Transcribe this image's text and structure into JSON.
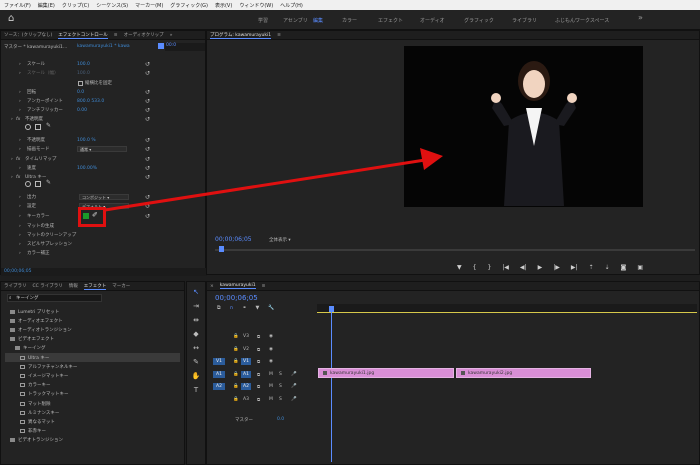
{
  "menu": [
    "ファイル(F)",
    "編集(E)",
    "クリップ(C)",
    "シーケンス(S)",
    "マーカー(M)",
    "グラフィック(G)",
    "表示(V)",
    "ウィンドウ(W)",
    "ヘルプ(H)"
  ],
  "workspaces": [
    "学習",
    "アセンブリ",
    "編集",
    "カラー",
    "エフェクト",
    "オーディオ",
    "グラフィック",
    "ライブラリ",
    "ふじもんワークスペース"
  ],
  "workspace_more": "»",
  "effect_panel": {
    "tabs": [
      "ソース：(クリップなし)",
      "エフェクトコントロール",
      "オーディオクリップ"
    ],
    "active_tab": "エフェクトコントロール",
    "menu_icon": "≡",
    "more": "»",
    "master_label": "マスター * kawamurayuki1...",
    "clip_label": "kawamurayuki1 * kawa",
    "timecode_marker": "00:0",
    "rows": [
      {
        "label": "スケール",
        "value": "100.0"
      },
      {
        "label": "スケール（幅）",
        "value": "100.0"
      },
      {
        "label": "縦横比を固定",
        "value": ""
      },
      {
        "label": "回転",
        "value": "0.0"
      },
      {
        "label": "アンカーポイント",
        "value": "800.0    533.0"
      },
      {
        "label": "アンチフリッカー",
        "value": "0.00"
      },
      {
        "label": "不透明度",
        "value": ""
      },
      {
        "label": "不透明度",
        "value": "100.0 %"
      },
      {
        "label": "描画モード",
        "value": "通常"
      },
      {
        "label": "タイムリマップ",
        "value": ""
      },
      {
        "label": "速度",
        "value": "100.00%"
      },
      {
        "label": "Ultra キー",
        "value": ""
      },
      {
        "label": "出力",
        "value": "コンポジット"
      },
      {
        "label": "設定",
        "value": "デフォルト"
      },
      {
        "label": "キーカラー",
        "value": ""
      },
      {
        "label": "マットの生成",
        "value": ""
      },
      {
        "label": "マットのクリーンアップ",
        "value": ""
      },
      {
        "label": "スピルサプレッション",
        "value": ""
      },
      {
        "label": "カラー補正",
        "value": ""
      }
    ],
    "footer_time": "00;00;06;05"
  },
  "program": {
    "title": "プログラム: kawamurayuki1",
    "menu_icon": "≡",
    "timecode": "00;00;06;05",
    "fit": "全体表示",
    "controls": [
      "marker-add",
      "in",
      "out",
      "go-in",
      "step-back",
      "play",
      "step-forward",
      "go-out",
      "lift",
      "extract",
      "export-frame",
      "compare"
    ]
  },
  "effects_panel": {
    "tabs": [
      "ライブラリ",
      "CC ライブラリ",
      "情報",
      "エフェクト",
      "マーカー"
    ],
    "active_tab": "エフェクト",
    "search_value": "キーイング",
    "items": [
      {
        "label": "Lumetri プリセット",
        "indent": 1,
        "type": "folder"
      },
      {
        "label": "オーディオエフェクト",
        "indent": 1,
        "type": "folder"
      },
      {
        "label": "オーディオトランジション",
        "indent": 1,
        "type": "folder"
      },
      {
        "label": "ビデオエフェクト",
        "indent": 1,
        "type": "folder"
      },
      {
        "label": "キーイング",
        "indent": 2,
        "type": "folder"
      },
      {
        "label": "Ultra キー",
        "indent": 3,
        "type": "fx",
        "selected": true
      },
      {
        "label": "アルファチャンネルキー",
        "indent": 3,
        "type": "fx"
      },
      {
        "label": "イメージマットキー",
        "indent": 3,
        "type": "fx"
      },
      {
        "label": "カラーキー",
        "indent": 3,
        "type": "fx"
      },
      {
        "label": "トラックマットキー",
        "indent": 3,
        "type": "fx"
      },
      {
        "label": "マット削除",
        "indent": 3,
        "type": "fx"
      },
      {
        "label": "ルミナンスキー",
        "indent": 3,
        "type": "fx"
      },
      {
        "label": "異なるマット",
        "indent": 3,
        "type": "fx"
      },
      {
        "label": "非赤キー",
        "indent": 3,
        "type": "fx"
      },
      {
        "label": "ビデオトランジション",
        "indent": 1,
        "type": "folder"
      }
    ]
  },
  "timeline": {
    "tab": "kawamurayuki1",
    "menu_icon": "≡",
    "timecode": "00;00;06;05",
    "tracks": [
      {
        "name": "V3",
        "kind": "video"
      },
      {
        "name": "V2",
        "kind": "video"
      },
      {
        "name": "V1",
        "kind": "video",
        "source": "V1"
      },
      {
        "name": "A1",
        "kind": "audio",
        "source": "A1"
      },
      {
        "name": "A2",
        "kind": "audio",
        "source": "A2"
      },
      {
        "name": "A3",
        "kind": "audio"
      }
    ],
    "master_label": "マスター",
    "master_value": "0.0",
    "clips": [
      {
        "label": "kawamurayuki1.jpg"
      },
      {
        "label": "kawamurayuki2.jpg"
      }
    ],
    "track_buttons": [
      "M",
      "S"
    ]
  },
  "annotation": {
    "color": "#e01010"
  }
}
